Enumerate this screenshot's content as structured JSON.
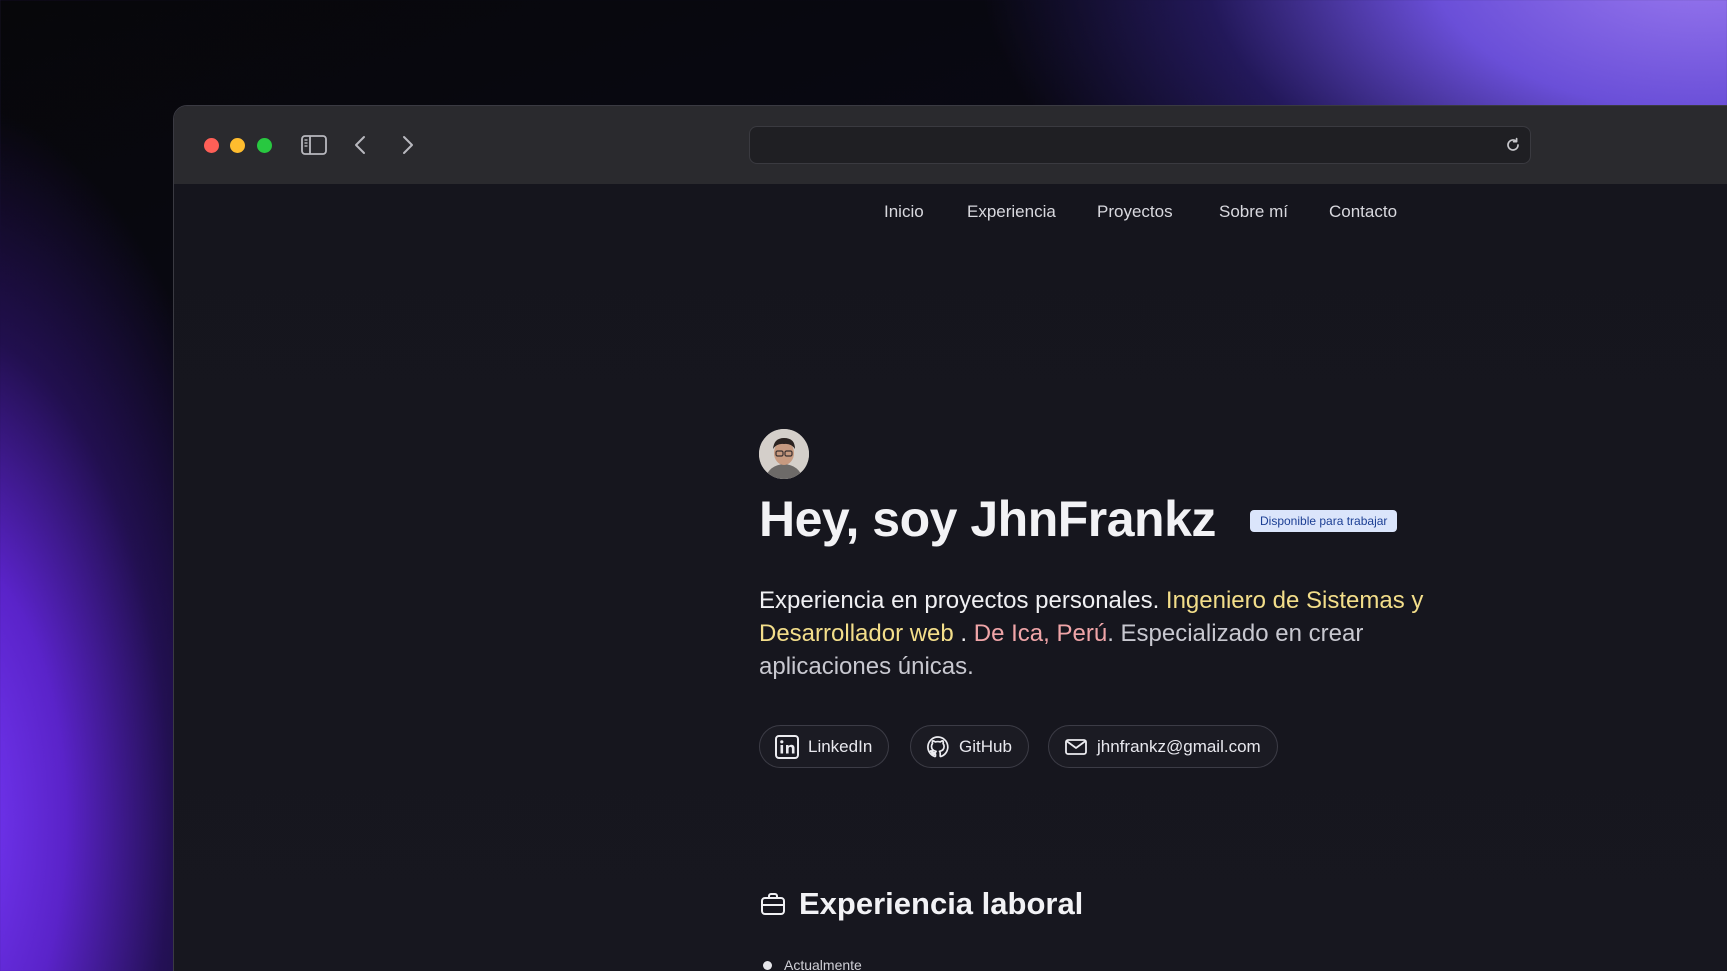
{
  "nav": {
    "items": [
      "Inicio",
      "Experiencia",
      "Proyectos",
      "Sobre mí",
      "Contacto"
    ]
  },
  "hero": {
    "headline": "Hey, soy JhnFrankz",
    "badge": "Disponible para trabajar",
    "bio": {
      "part1": "Experiencia en proyectos personales.",
      "highlight_role": "Ingeniero de Sistemas y Desarrollador web",
      "sep": " .",
      "highlight_place": "De Ica, Perú",
      "part2": ". Especializado en crear aplicaciones únicas."
    },
    "links": {
      "linkedin": "LinkedIn",
      "github": "GitHub",
      "email": "jhnfrankz@gmail.com"
    }
  },
  "experience": {
    "title": "Experiencia laboral",
    "first_item": "Actualmente"
  },
  "colors": {
    "highlight_yellow": "#f3de8a",
    "highlight_pink": "#f0a5a8",
    "badge_bg": "#dbe5fb",
    "badge_text": "#1c3f94"
  },
  "icons": [
    "sidebar-toggle-icon",
    "chevron-left-icon",
    "chevron-right-icon",
    "reload-icon",
    "linkedin-icon",
    "github-icon",
    "mail-icon",
    "briefcase-icon"
  ]
}
